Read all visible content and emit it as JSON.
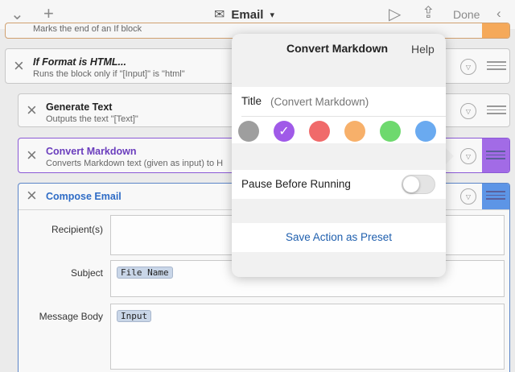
{
  "toolbar": {
    "title": "Email",
    "caret": "▾",
    "done_label": "Done",
    "icons": [
      "chevron-down-icon",
      "plus-icon",
      "email-icon",
      "play-icon",
      "share-icon",
      "chevron-left-icon"
    ]
  },
  "blocks": [
    {
      "desc": "Marks the end of an If block",
      "strip_color": "#f5a95a"
    },
    {
      "title": "If Format is HTML...",
      "desc": "Runs the block only if \"[Input]\" is \"html\""
    },
    {
      "title": "Generate Text",
      "desc": "Outputs the text \"[Text]\""
    },
    {
      "title": "Convert Markdown",
      "desc": "Converts Markdown text (given as input) to H",
      "color": "#8b59d6"
    },
    {
      "title": "Compose Email",
      "color": "#2f6cc6"
    }
  ],
  "compose": {
    "recipients_label": "Recipient(s)",
    "subject_label": "Subject",
    "subject_token": "File Name",
    "body_label": "Message Body",
    "body_token": "Input"
  },
  "popover": {
    "title": "Convert Markdown",
    "help_label": "Help",
    "title_field_label": "Title",
    "title_field_placeholder": "(Convert Markdown)",
    "colors": [
      "#9e9e9e",
      "#a05ae8",
      "#f06a6a",
      "#f7b06a",
      "#6ed96e",
      "#6aaaf0"
    ],
    "selected_color_index": 1,
    "pause_label": "Pause Before Running",
    "pause_on": false,
    "preset_label": "Save Action as Preset"
  }
}
